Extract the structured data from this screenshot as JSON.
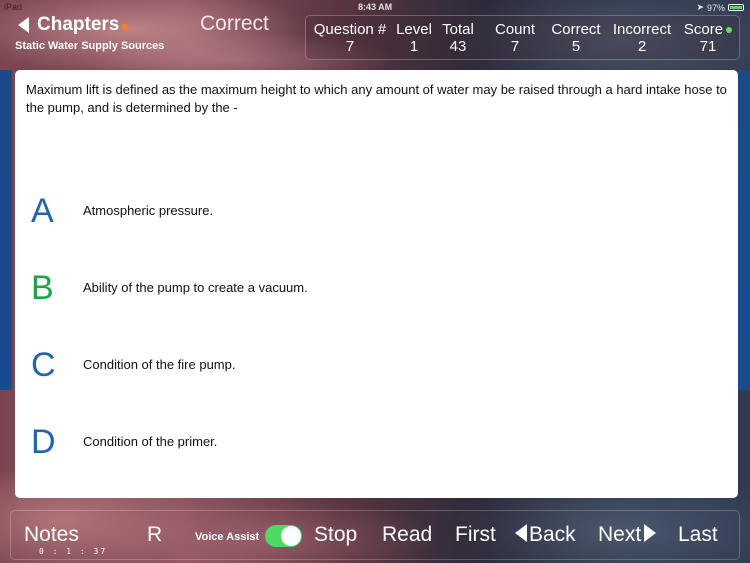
{
  "status_bar": {
    "device": "iPad",
    "time": "8:43 AM",
    "battery": "97%",
    "battery_level": 0.97
  },
  "header": {
    "back_label": "Chapters",
    "subtitle": "Static Water Supply Sources",
    "result_status": "Correct"
  },
  "stats": [
    {
      "label": "Question #",
      "value": "7"
    },
    {
      "label": "Level",
      "value": "1"
    },
    {
      "label": "Total",
      "value": "43"
    },
    {
      "label": "Count",
      "value": "7"
    },
    {
      "label": "Correct",
      "value": "5"
    },
    {
      "label": "Incorrect",
      "value": "2"
    },
    {
      "label": "Score",
      "value": "71"
    }
  ],
  "question": {
    "text": "Maximum lift is defined as the maximum height to which any amount of water may be raised through a hard intake hose to the pump, and is determined by the -",
    "answers": [
      {
        "letter": "A",
        "text": "Atmospheric pressure.",
        "color": "#1e64b4"
      },
      {
        "letter": "B",
        "text": "Ability of the pump to create a vacuum.",
        "color": "#1fa34a"
      },
      {
        "letter": "C",
        "text": "Condition of the fire pump.",
        "color": "#1e64b4"
      },
      {
        "letter": "D",
        "text": "Condition of the primer.",
        "color": "#1e64b4"
      }
    ]
  },
  "toolbar": {
    "notes_label": "Notes",
    "timer": "0 : 1 : 37",
    "r_label": "R",
    "voice_assist_label": "Voice Assist",
    "voice_assist_on": true,
    "stop_label": "Stop",
    "read_label": "Read",
    "first_label": "First",
    "back_label": "Back",
    "next_label": "Next",
    "last_label": "Last"
  },
  "colors": {
    "accent_blue": "#1e64b4",
    "correct_green": "#1fa34a",
    "toggle_green": "#4cd964",
    "indicator_orange": "#ff7a1a",
    "indicator_green": "#5fe05a"
  }
}
